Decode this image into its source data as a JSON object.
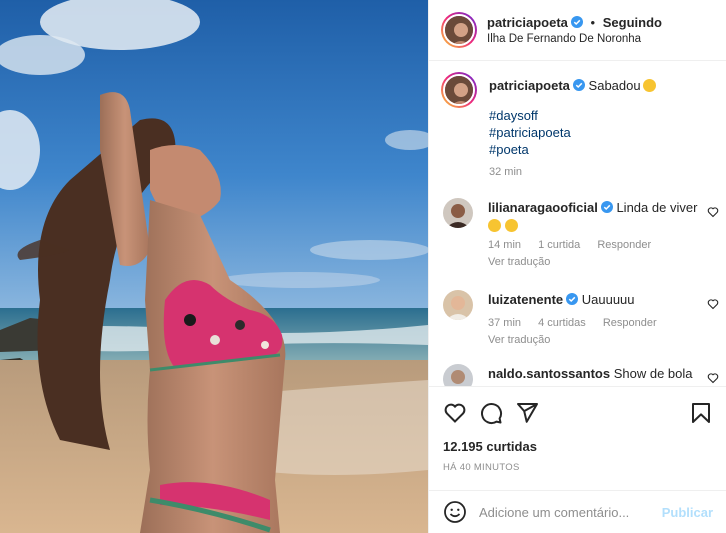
{
  "post": {
    "username": "patriciapoeta",
    "separator": "•",
    "follow_status": "Seguindo",
    "location": "Ilha De Fernando De Noronha"
  },
  "caption": {
    "username": "patriciapoeta",
    "text": "Sabadou",
    "hashtags": [
      "#daysoff",
      "#patriciapoeta",
      "#poeta"
    ],
    "time": "32 min"
  },
  "comments": [
    {
      "username": "lilianaragaooficial",
      "text": "Linda de viver",
      "time": "14 min",
      "likes": "1 curtida",
      "reply": "Responder",
      "translate": "Ver tradução"
    },
    {
      "username": "luizatenente",
      "text": "Uauuuuu",
      "time": "37 min",
      "likes": "4 curtidas",
      "reply": "Responder",
      "translate": "Ver tradução"
    },
    {
      "username": "naldo.santossantos",
      "text": "Show de bola"
    }
  ],
  "footer": {
    "likes": "12.195 curtidas",
    "ago": "HÁ 40 MINUTOS",
    "comment_placeholder": "Adicione um comentário...",
    "publish_label": "Publicar"
  },
  "colors": {
    "link": "#00376b",
    "muted": "#8e8e8e",
    "verified": "#3897f0",
    "publish_disabled": "#b2dffc"
  }
}
